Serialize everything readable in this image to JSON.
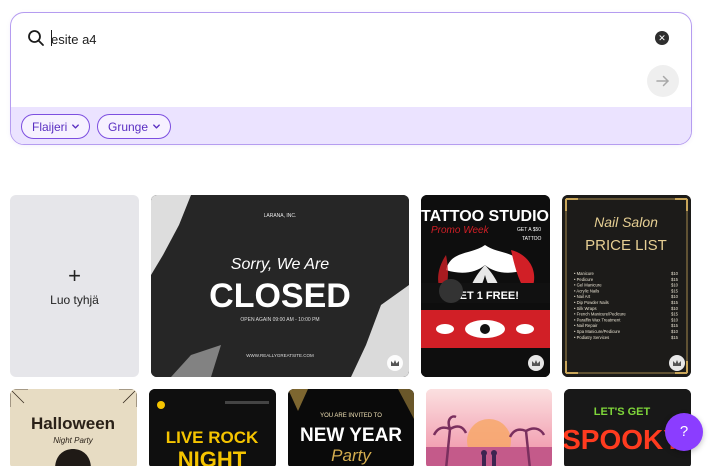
{
  "search": {
    "value": "esite a4",
    "placeholder": ""
  },
  "filters": [
    {
      "label": "Flaijeri"
    },
    {
      "label": "Grunge"
    }
  ],
  "create_blank": {
    "plus": "+",
    "label": "Luo tyhjä"
  },
  "templates": {
    "closed": {
      "company": "LARANA, INC.",
      "script": "Sorry, We Are",
      "title": "CLOSED",
      "hours": "OPEN AGAIN 09:00 AM - 10:00 PM",
      "url": "WWW.REALLYGREATSITE.COM"
    },
    "tattoo": {
      "title": "TATTOO STUDIO",
      "subtitle": "Promo Week",
      "offer": "GET A $50",
      "offer2": "TATTOO",
      "promo": "GET 1 FREE!"
    },
    "nails": {
      "script": "Nail Salon",
      "title": "PRICE LIST",
      "items": [
        {
          "name": "Manicure",
          "price": "$10"
        },
        {
          "name": "Pedicure",
          "price": "$15"
        },
        {
          "name": "Gel Manicure",
          "price": "$10"
        },
        {
          "name": "Acrylic Nails",
          "price": "$15"
        },
        {
          "name": "Nail Art",
          "price": "$10"
        },
        {
          "name": "Dip Powder Nails",
          "price": "$15"
        },
        {
          "name": "Silk Wraps",
          "price": "$10"
        },
        {
          "name": "French Manicure/Pedicure",
          "price": "$15"
        },
        {
          "name": "Paraffin Wax Treatment",
          "price": "$10"
        },
        {
          "name": "Nail Repair",
          "price": "$15"
        },
        {
          "name": "Spa Manicure/Pedicure",
          "price": "$10"
        },
        {
          "name": "Podiatry Services",
          "price": "$15"
        }
      ]
    },
    "halloween": {
      "title": "Halloween",
      "subtitle": "Night Party"
    },
    "rock": {
      "title": "LIVE ROCK",
      "title2": "NIGHT"
    },
    "newyear": {
      "invite": "YOU ARE INVITED TO",
      "title": "NEW YEAR",
      "script": "Party"
    },
    "spooky": {
      "title": "LET'S GET",
      "title2": "SPOOKY"
    }
  },
  "help": {
    "label": "?"
  },
  "colors": {
    "accent": "#8b3dff",
    "chip_border": "#7d4fe0",
    "filter_bg": "#ebe3ff",
    "tattoo_red": "#d11f26"
  },
  "icons": [
    "search-icon",
    "clear-icon",
    "arrow-right-icon",
    "chevron-down-icon",
    "pro-crown-icon"
  ]
}
